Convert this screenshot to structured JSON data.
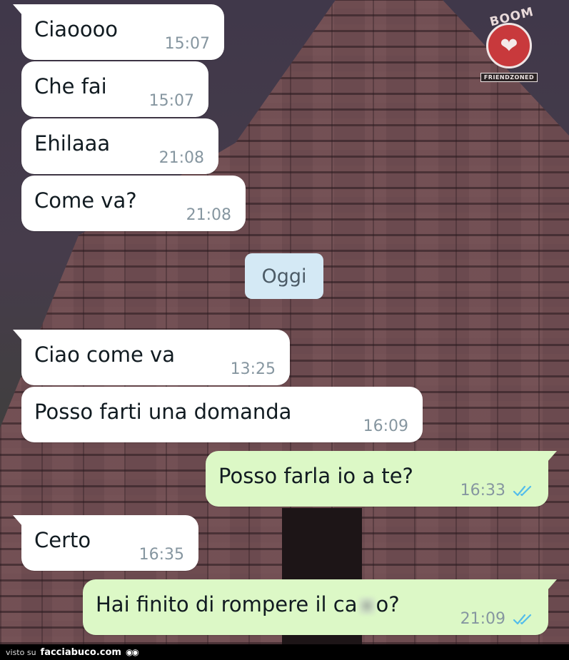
{
  "watermark": {
    "boom": "BOOM",
    "label": "FRIENDZONED"
  },
  "messages": [
    {
      "text": "Ciaoooo",
      "time": "15:07",
      "direction": "in"
    },
    {
      "text": "Che fai",
      "time": "15:07",
      "direction": "in"
    },
    {
      "text": "Ehilaaa",
      "time": "21:08",
      "direction": "in"
    },
    {
      "text": "Come va?",
      "time": "21:08",
      "direction": "in"
    },
    {
      "text": "Ciao come va",
      "time": "13:25",
      "direction": "in"
    },
    {
      "text": "Posso farti una domanda",
      "time": "16:09",
      "direction": "in"
    },
    {
      "text": "Posso farla io a te?",
      "time": "16:33",
      "direction": "out",
      "status": "read"
    },
    {
      "text": "Certo",
      "time": "16:35",
      "direction": "in"
    },
    {
      "text_before": "Hai finito di rompere il ca",
      "text_after": "o?",
      "time": "21:09",
      "direction": "out",
      "status": "read"
    }
  ],
  "date_divider": "Oggi",
  "footer": {
    "visto": "visto su",
    "site": "facciabuco.com"
  },
  "colors": {
    "incoming": "#ffffff",
    "outgoing": "#dcf8c6",
    "read_ticks": "#53bdeb",
    "divider": "#d4e9f5"
  }
}
